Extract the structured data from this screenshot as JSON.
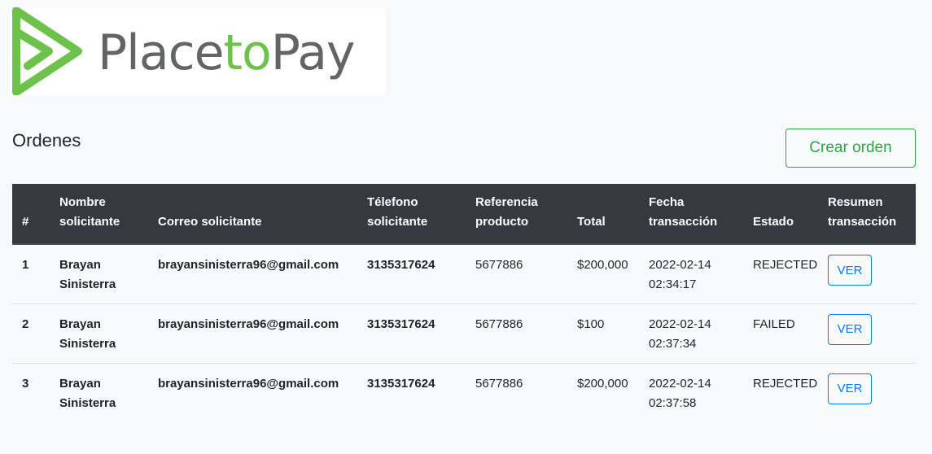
{
  "brand": {
    "name_part1": "Place",
    "name_part2": "to",
    "name_part3": "Pay",
    "colors": {
      "green": "#6cc24a",
      "gray": "#636466"
    }
  },
  "page": {
    "title": "Ordenes",
    "create_button_label": "Crear orden"
  },
  "table": {
    "headers": {
      "num": "#",
      "name_l1": "Nombre",
      "name_l2": "solicitante",
      "email": "Correo solicitante",
      "phone_l1": "Télefono",
      "phone_l2": "solicitante",
      "ref_l1": "Referencia",
      "ref_l2": "producto",
      "total": "Total",
      "date_l1": "Fecha",
      "date_l2": "transacción",
      "state": "Estado",
      "summary_l1": "Resumen",
      "summary_l2": "transacción"
    },
    "rows": [
      {
        "num": "1",
        "name_l1": "Brayan",
        "name_l2": "Sinisterra",
        "email": "brayansinisterra96@gmail.com",
        "phone": "3135317624",
        "ref": "5677886",
        "total": "$200,000",
        "date_l1": "2022-02-14",
        "date_l2": "02:34:17",
        "state": "REJECTED",
        "action": "VER"
      },
      {
        "num": "2",
        "name_l1": "Brayan",
        "name_l2": "Sinisterra",
        "email": "brayansinisterra96@gmail.com",
        "phone": "3135317624",
        "ref": "5677886",
        "total": "$100",
        "date_l1": "2022-02-14",
        "date_l2": "02:37:34",
        "state": "FAILED",
        "action": "VER"
      },
      {
        "num": "3",
        "name_l1": "Brayan",
        "name_l2": "Sinisterra",
        "email": "brayansinisterra96@gmail.com",
        "phone": "3135317624",
        "ref": "5677886",
        "total": "$200,000",
        "date_l1": "2022-02-14",
        "date_l2": "02:37:58",
        "state": "REJECTED",
        "action": "VER"
      }
    ]
  }
}
